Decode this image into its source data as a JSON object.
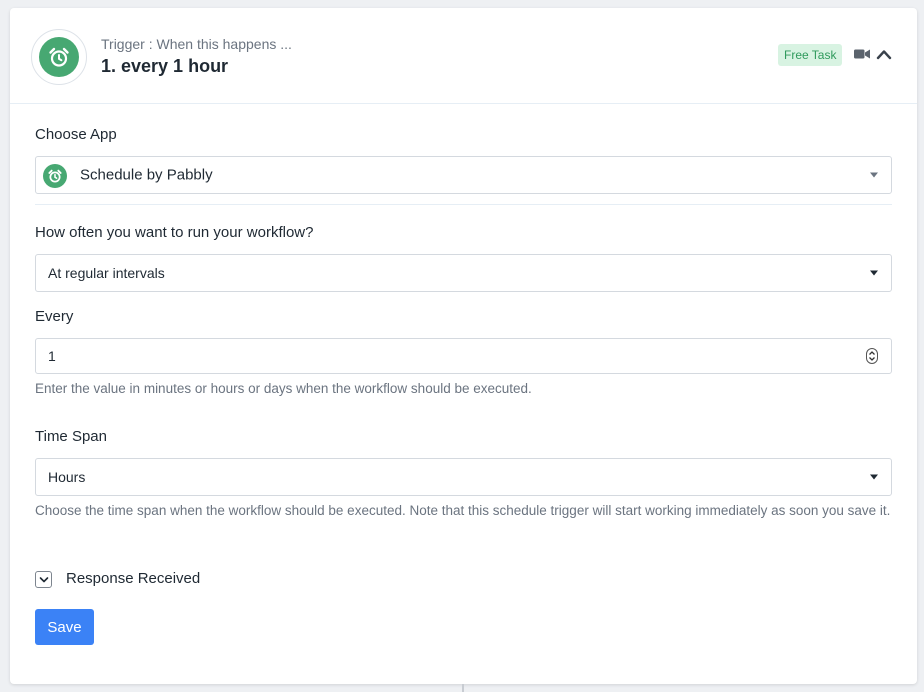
{
  "header": {
    "subtitle": "Trigger : When this happens ...",
    "title": "1. every 1 hour",
    "badge": "Free Task",
    "badge_color": "#2f9a5c",
    "app_icon": "alarm-clock-icon",
    "app_color": "#47a872"
  },
  "choose_app": {
    "label": "Choose App",
    "value": "Schedule by Pabbly"
  },
  "frequency": {
    "label": "How often you want to run your workflow?",
    "value": "At regular intervals"
  },
  "every": {
    "label": "Every",
    "value": "1",
    "help": "Enter the value in minutes or hours or days when the workflow should be executed."
  },
  "time_span": {
    "label": "Time Span",
    "value": "Hours",
    "help": "Choose the time span when the workflow should be executed. Note that this schedule trigger will start working immediately as soon you save it."
  },
  "response": {
    "label": "Response Received"
  },
  "actions": {
    "save_label": "Save",
    "save_color": "#3b82f6"
  }
}
